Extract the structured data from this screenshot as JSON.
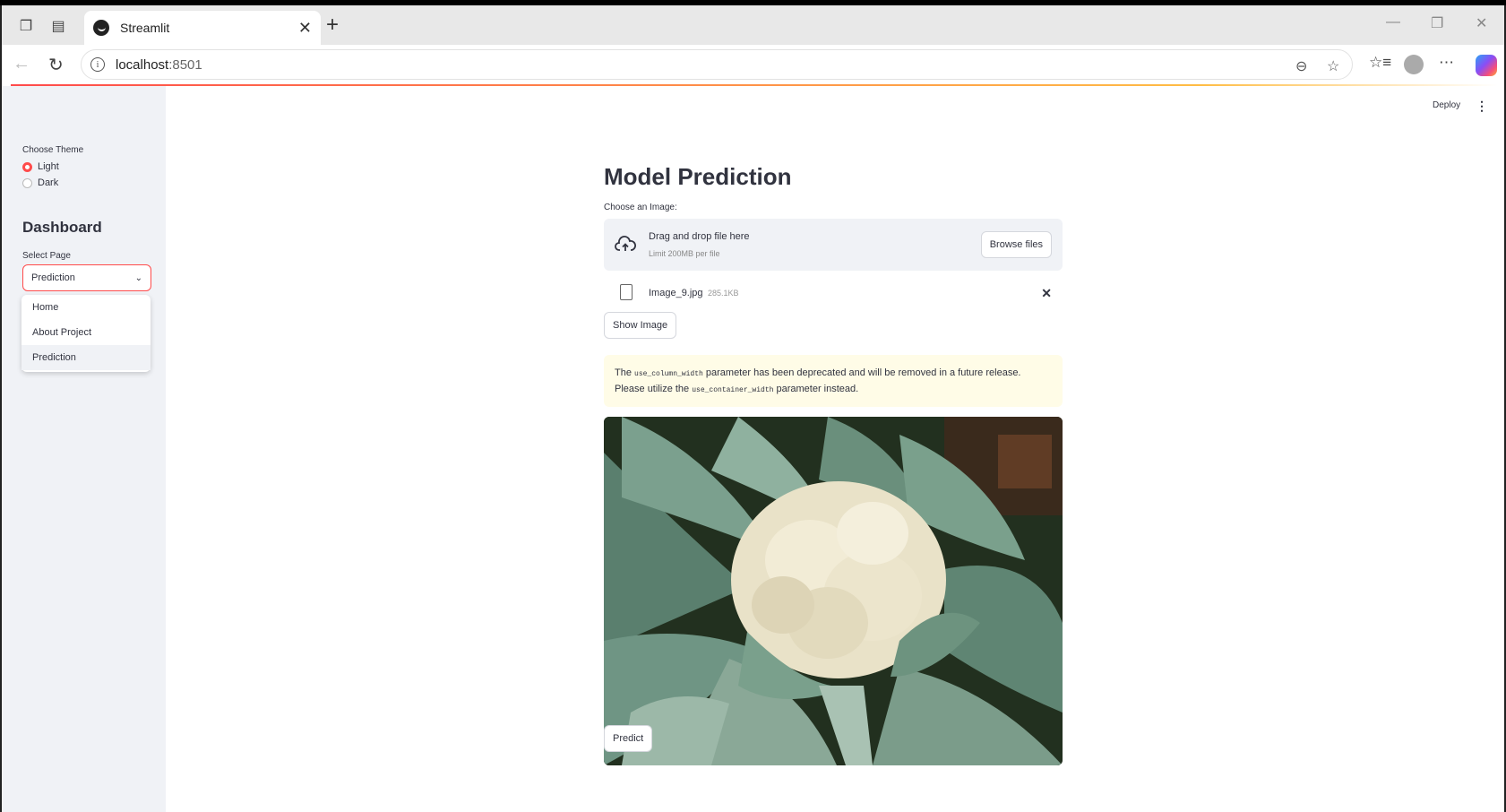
{
  "browser": {
    "tab_title": "Streamlit",
    "url_host": "localhost",
    "url_port": ":8501"
  },
  "header": {
    "deploy_label": "Deploy"
  },
  "sidebar": {
    "theme_label": "Choose Theme",
    "theme_options": [
      "Light",
      "Dark"
    ],
    "theme_selected": "Light",
    "heading": "Dashboard",
    "select_label": "Select Page",
    "select_value": "Prediction",
    "page_options": [
      "Home",
      "About Project",
      "Prediction"
    ]
  },
  "main": {
    "title": "Model Prediction",
    "uploader_label": "Choose an Image:",
    "dropzone_text": "Drag and drop file here",
    "dropzone_limit": "Limit 200MB per file",
    "browse_label": "Browse files",
    "file_name": "Image_9.jpg",
    "file_size": "285.1KB",
    "show_image_label": "Show Image",
    "warning": {
      "part1": "The ",
      "code1": "use_column_width",
      "part2": " parameter has been deprecated and will be removed in a future release. Please utilize the ",
      "code2": "use_container_width",
      "part3": " parameter instead."
    },
    "image_subject": "cauliflower-photo",
    "predict_label": "Predict"
  },
  "colors": {
    "accent": "#ff4b4b",
    "sidebar_bg": "#f0f2f6",
    "warning_bg": "#fffce7"
  }
}
